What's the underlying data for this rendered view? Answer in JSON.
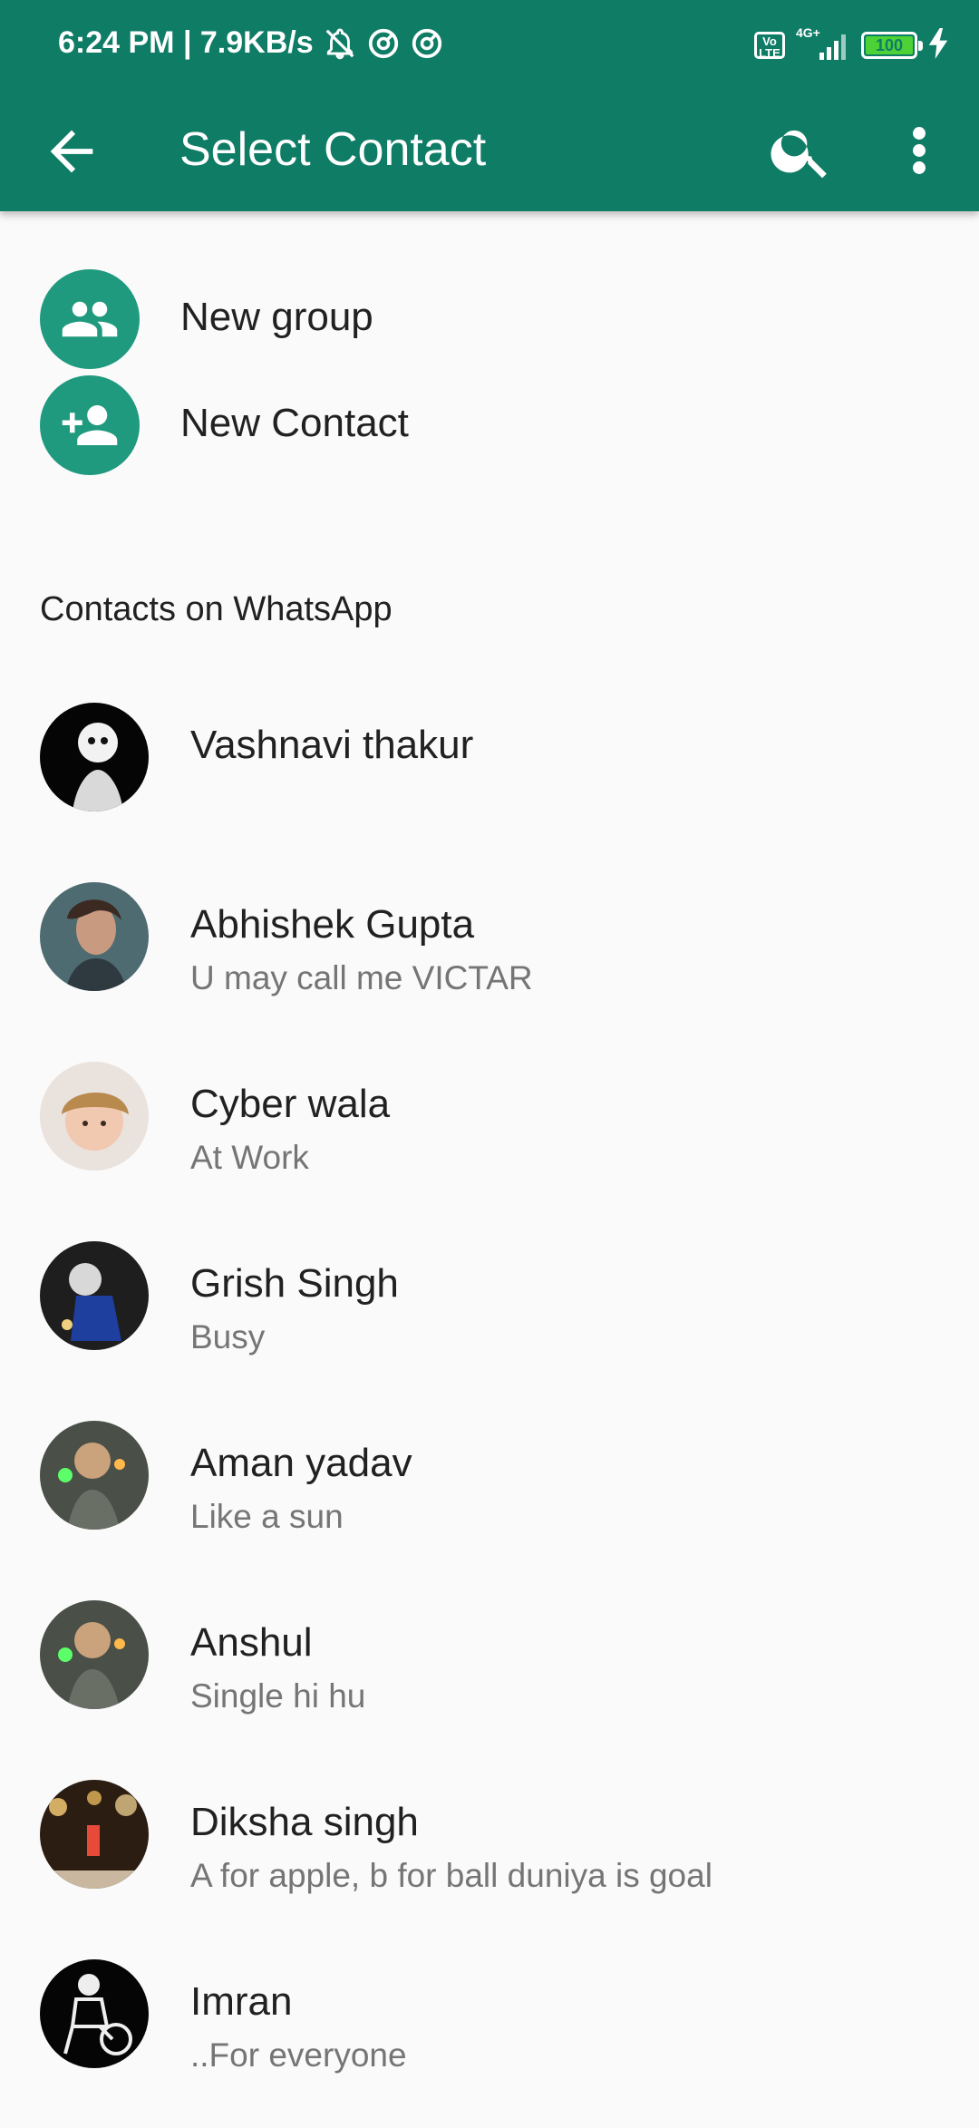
{
  "status_bar": {
    "time_speed": "6:24 PM | 7.9KB/s",
    "network": "4G+",
    "volte": "Vo LTE",
    "battery": "100"
  },
  "toolbar": {
    "title": "Select Contact"
  },
  "actions": [
    {
      "label": "New group",
      "icon": "group-icon"
    },
    {
      "label": "New Contact",
      "icon": "add-person-icon"
    }
  ],
  "section_header": "Contacts on WhatsApp",
  "contacts": [
    {
      "name": "Vashnavi thakur",
      "status": ""
    },
    {
      "name": "Abhishek Gupta",
      "status": "U may call me VICTAR"
    },
    {
      "name": "Cyber wala",
      "status": "At Work"
    },
    {
      "name": "Grish Singh",
      "status": "Busy"
    },
    {
      "name": "Aman yadav",
      "status": "Like a sun"
    },
    {
      "name": "Anshul",
      "status": "Single hi hu"
    },
    {
      "name": "Diksha singh",
      "status": "A for apple, b for ball duniya is goal"
    },
    {
      "name": "Imran",
      "status": "..For everyone"
    }
  ],
  "colors": {
    "primary": "#0f7c66",
    "accent": "#1f9a7e",
    "background": "#fafafa"
  }
}
